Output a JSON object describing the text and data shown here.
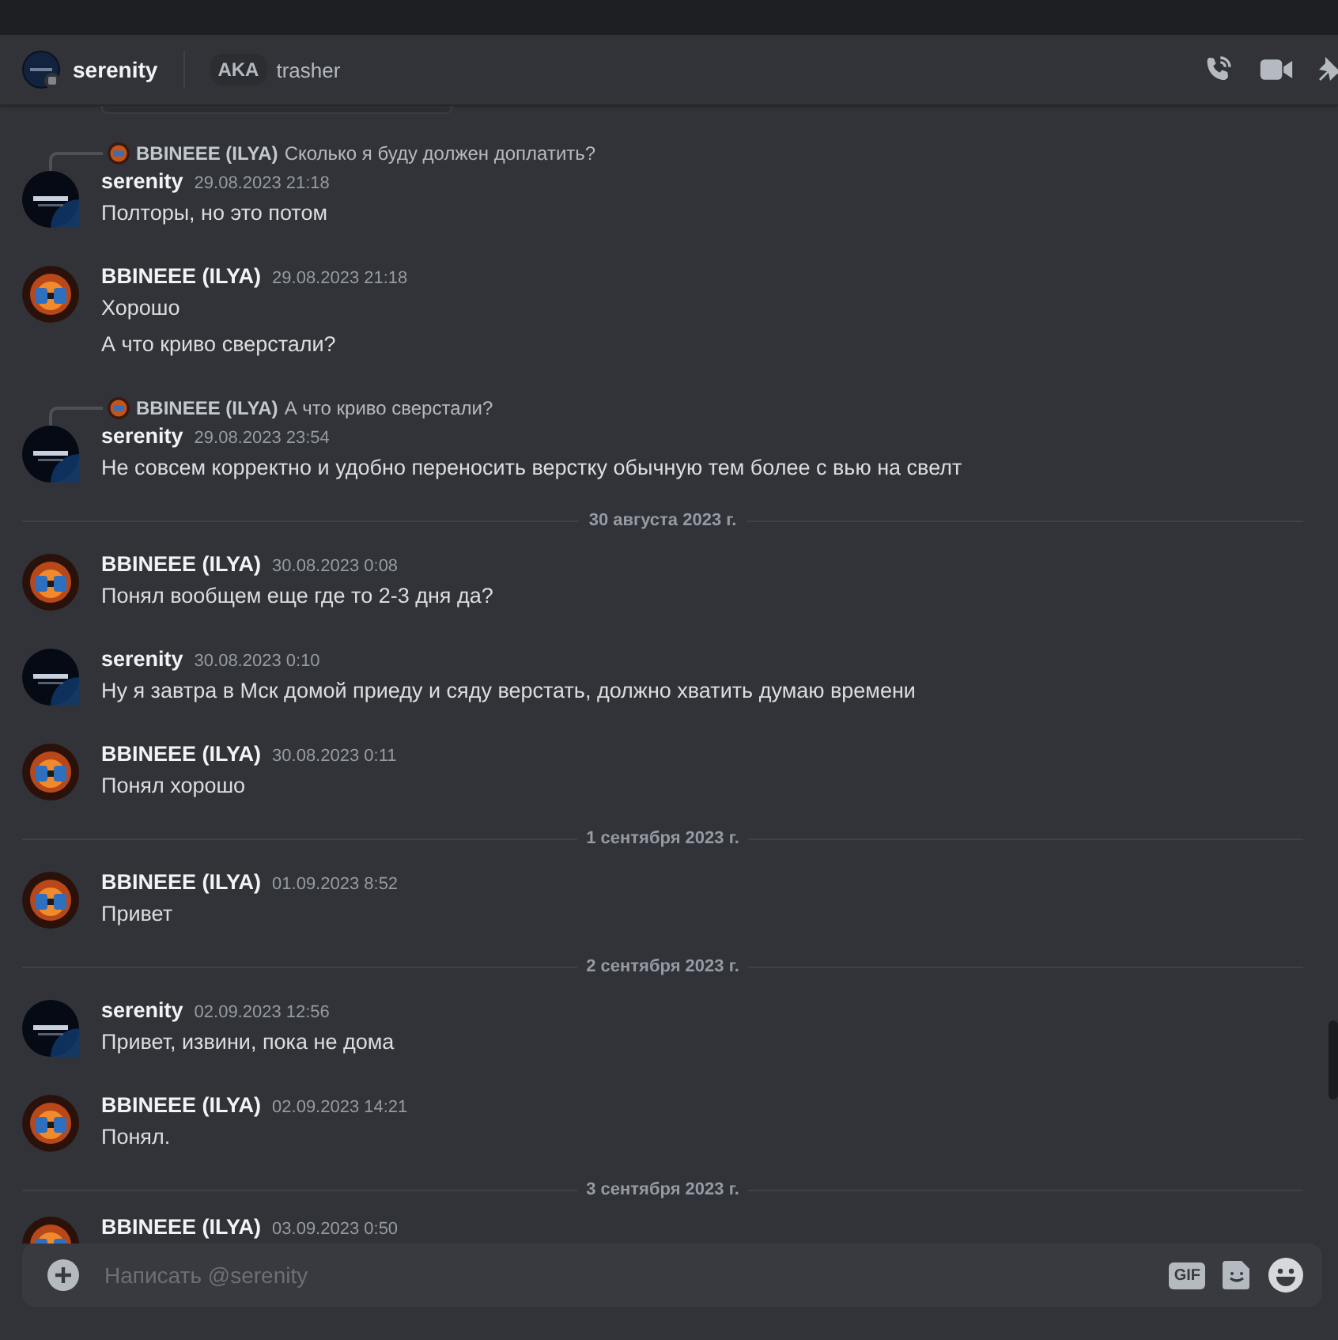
{
  "header": {
    "title": "serenity",
    "aka_label": "AKA",
    "aka_name": "trasher"
  },
  "feed": [
    {
      "kind": "message",
      "avatar": {
        "kind": "logo"
      },
      "reply": {
        "author": "BBINEEE (ILYA)",
        "text": "Сколько я буду должен доплатить?"
      },
      "author": "serenity",
      "time": "29.08.2023 21:18",
      "lines": [
        "Полторы, но это потом"
      ]
    },
    {
      "kind": "message",
      "avatar": {
        "kind": "fire"
      },
      "author": "BBINEEE (ILYA)",
      "time": "29.08.2023 21:18",
      "lines": [
        "Хорошо",
        "А что криво сверстали?"
      ]
    },
    {
      "kind": "message",
      "avatar": {
        "kind": "logo"
      },
      "reply": {
        "author": "BBINEEE (ILYA)",
        "text": "А что криво сверстали?"
      },
      "author": "serenity",
      "time": "29.08.2023 23:54",
      "lines": [
        "Не совсем корректно и удобно переносить верстку обычную тем более с вью на свелт"
      ]
    },
    {
      "kind": "divider",
      "text": "30 августа 2023 г."
    },
    {
      "kind": "message",
      "avatar": {
        "kind": "fire"
      },
      "author": "BBINEEE (ILYA)",
      "time": "30.08.2023 0:08",
      "lines": [
        "Понял вообщем еще где то 2-3 дня да?"
      ]
    },
    {
      "kind": "message",
      "avatar": {
        "kind": "logo"
      },
      "author": "serenity",
      "time": "30.08.2023 0:10",
      "lines": [
        "Ну я завтра в Мск домой приеду и сяду верстать, должно хватить думаю времени"
      ]
    },
    {
      "kind": "message",
      "avatar": {
        "kind": "fire"
      },
      "author": "BBINEEE (ILYA)",
      "time": "30.08.2023 0:11",
      "lines": [
        "Понял хорошо"
      ]
    },
    {
      "kind": "divider",
      "text": "1 сентября 2023 г."
    },
    {
      "kind": "message",
      "avatar": {
        "kind": "fire"
      },
      "author": "BBINEEE (ILYA)",
      "time": "01.09.2023 8:52",
      "lines": [
        "Привет"
      ]
    },
    {
      "kind": "divider",
      "text": "2 сентября 2023 г."
    },
    {
      "kind": "message",
      "avatar": {
        "kind": "logo"
      },
      "author": "serenity",
      "time": "02.09.2023 12:56",
      "lines": [
        "Привет, извини, пока не дома"
      ]
    },
    {
      "kind": "message",
      "avatar": {
        "kind": "fire"
      },
      "author": "BBINEEE (ILYA)",
      "time": "02.09.2023 14:21",
      "lines": [
        "Понял."
      ]
    },
    {
      "kind": "divider",
      "text": "3 сентября 2023 г."
    },
    {
      "kind": "message",
      "avatar": {
        "kind": "fire"
      },
      "author": "BBINEEE (ILYA)",
      "time": "03.09.2023 0:50"
    }
  ],
  "composer": {
    "placeholder": "Написать @serenity",
    "gif_label": "GIF"
  }
}
